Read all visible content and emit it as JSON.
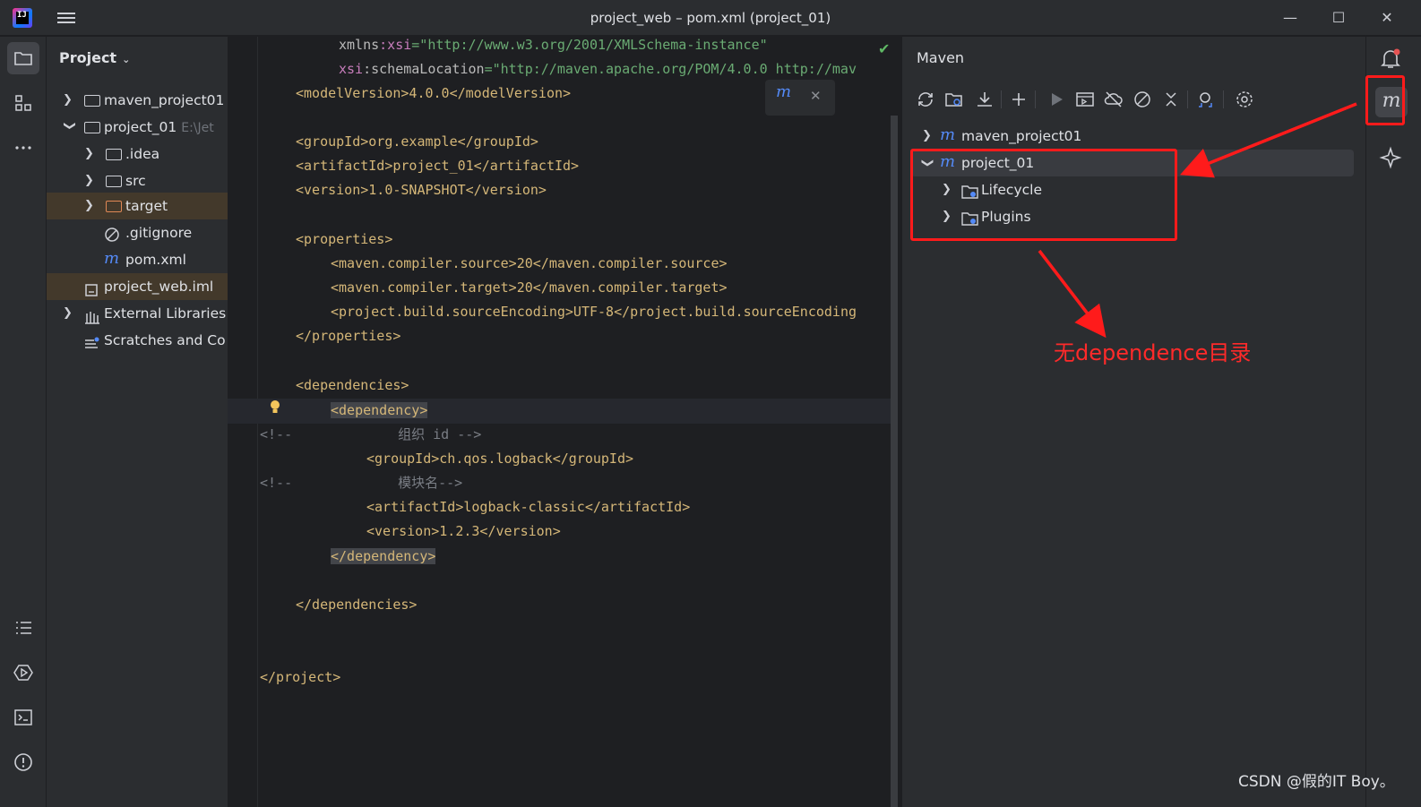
{
  "window": {
    "title": "project_web – pom.xml (project_01)",
    "app_icon": "intellij-idea-icon",
    "controls": [
      "minimize-icon",
      "maximize-icon",
      "close-icon"
    ]
  },
  "left_strip": {
    "top_icons": [
      "folder-icon",
      "structure-icon",
      "more-icon"
    ],
    "bottom_icons": [
      "todo-list-icon",
      "services-icon",
      "terminal-icon",
      "problems-icon"
    ]
  },
  "project_panel": {
    "title": "Project",
    "tree": [
      {
        "label": "maven_project01",
        "icon": "module-folder-icon",
        "expanded": false
      },
      {
        "label": "project_01",
        "hint": "E:\\Jet",
        "icon": "module-folder-icon",
        "expanded": true
      },
      {
        "label": ".idea",
        "icon": "folder-icon",
        "expanded": false
      },
      {
        "label": "src",
        "icon": "folder-icon",
        "expanded": false
      },
      {
        "label": "target",
        "icon": "folder-orange-icon",
        "expanded": false
      },
      {
        "label": ".gitignore",
        "icon": "ignore-file-icon"
      },
      {
        "label": "pom.xml",
        "icon": "maven-m-icon"
      },
      {
        "label": "project_web.iml",
        "icon": "iml-file-icon"
      },
      {
        "label": "External Libraries",
        "icon": "library-icon",
        "expanded": false
      },
      {
        "label": "Scratches and Co",
        "icon": "scratches-icon"
      }
    ]
  },
  "editor": {
    "lines": {
      "l1_a": "xmlns",
      "l1_b": ":xsi",
      "l1_c": "=\"http://www.w3.org/2001/XMLSchema-instance\"",
      "l2_a": "xsi",
      "l2_b": ":schemaLocation",
      "l2_c": "=\"http://maven.apache.org/POM/4.0.0 http://mav",
      "l3": "<modelVersion>4.0.0</modelVersion>",
      "l5": "<groupId>org.example</groupId>",
      "l6": "<artifactId>project_01</artifactId>",
      "l7": "<version>1.0-SNAPSHOT</version>",
      "l9": "<properties>",
      "l10": "<maven.compiler.source>20</maven.compiler.source>",
      "l11": "<maven.compiler.target>20</maven.compiler.target>",
      "l12": "<project.build.sourceEncoding>UTF-8</project.build.sourceEncoding",
      "l13": "</properties>",
      "l15": "<dependencies>",
      "l16": "<dependency>",
      "l17_a": "<!--",
      "l17_b": "组织 id -->",
      "l18": "<groupId>ch.qos.logback</groupId>",
      "l19_a": "<!--",
      "l19_b": "模块名-->",
      "l20": "<artifactId>logback-classic</artifactId>",
      "l21": "<version>1.2.3</version>",
      "l22": "</dependency>",
      "l24": "</dependencies>",
      "l27": "</project>"
    }
  },
  "maven_panel": {
    "title": "Maven",
    "toolbar": [
      "reload-icon",
      "reload-folder-icon",
      "download-icon",
      "add-icon",
      "run-icon",
      "execute-goal-icon",
      "offline-icon",
      "skip-tests-icon",
      "collapse-icon",
      "analyze-deps-icon",
      "settings-icon"
    ],
    "tree": [
      {
        "label": "maven_project01",
        "icon": "maven-m-icon",
        "expanded": false
      },
      {
        "label": "project_01",
        "icon": "maven-m-icon",
        "expanded": true
      },
      {
        "label": "Lifecycle",
        "icon": "lifecycle-folder-icon",
        "expanded": false
      },
      {
        "label": "Plugins",
        "icon": "plugins-folder-icon",
        "expanded": false
      }
    ]
  },
  "right_strip": {
    "icons": [
      "notifications-icon",
      "maven-m-icon",
      "ai-assistant-icon"
    ]
  },
  "annotation": {
    "text": "无dependence目录",
    "color": "#ff2a2a"
  },
  "watermark": "CSDN @假的IT Boy。",
  "colors": {
    "background": "#1e1f22",
    "panel": "#2b2d30",
    "xml_tag": "#d5b778",
    "string": "#6aab73",
    "namespace": "#c77dbb",
    "comment": "#7a7e85",
    "maven_blue": "#548af7",
    "annotation_red": "#ff1b1b"
  }
}
